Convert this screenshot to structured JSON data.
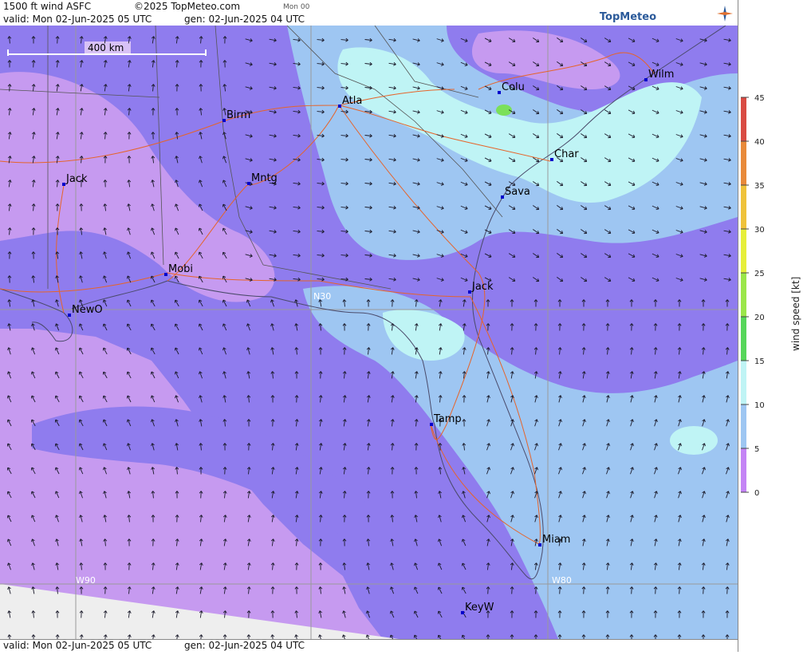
{
  "header": {
    "title": "1500 ft wind ASFC",
    "copyright": "©2025 TopMeteo.com",
    "step": "Mon 00",
    "valid": "valid:  Mon  02-Jun-2025  05 UTC",
    "generated": "gen: 02-Jun-2025 04 UTC",
    "logo": "TopMeteo"
  },
  "footer": {
    "valid": "valid:  Mon  02-Jun-2025  05 UTC",
    "generated": "gen: 02-Jun-2025 04 UTC"
  },
  "map": {
    "scale_label": "400 km",
    "grid_labels": [
      "N30",
      "W90",
      "W80"
    ],
    "cities": [
      {
        "name": "Birm"
      },
      {
        "name": "Atla"
      },
      {
        "name": "Colu"
      },
      {
        "name": "Wilm"
      },
      {
        "name": "Jack"
      },
      {
        "name": "Mntg"
      },
      {
        "name": "Char"
      },
      {
        "name": "Sava"
      },
      {
        "name": "Mobi"
      },
      {
        "name": "NewO"
      },
      {
        "name": "Jack"
      },
      {
        "name": "Tamp"
      },
      {
        "name": "Miam"
      },
      {
        "name": "KeyW"
      }
    ]
  },
  "legend": {
    "title": "wind speed [kt]",
    "ticks": [
      "45",
      "40",
      "35",
      "30",
      "25",
      "20",
      "15",
      "10",
      "5",
      "0"
    ],
    "colors": [
      "#d94b43",
      "#e88a3a",
      "#efc23a",
      "#e6ef3a",
      "#9be64a",
      "#56d65a",
      "#bff4f5",
      "#9ec6f2",
      "#7f7ff0",
      "#c484f5"
    ]
  }
}
